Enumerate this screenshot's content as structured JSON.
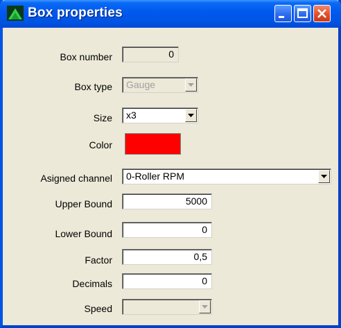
{
  "window": {
    "title": "Box properties"
  },
  "fields": {
    "box_number": {
      "label": "Box number",
      "value": "0"
    },
    "box_type": {
      "label": "Box type",
      "value": "Gauge"
    },
    "size": {
      "label": "Size",
      "value": "x3"
    },
    "color": {
      "label": "Color",
      "value": "#ff0000"
    },
    "assigned_channel": {
      "label": "Asigned channel",
      "value": "0-Roller RPM"
    },
    "upper_bound": {
      "label": "Upper Bound",
      "value": "5000"
    },
    "lower_bound": {
      "label": "Lower Bound",
      "value": "0"
    },
    "factor": {
      "label": "Factor",
      "value": "0,5"
    },
    "decimals": {
      "label": "Decimals",
      "value": "0"
    },
    "speed": {
      "label": "Speed",
      "value": ""
    }
  },
  "icons": {
    "app": "green-gauge-icon",
    "minimize": "minimize-icon",
    "maximize": "maximize-icon",
    "close": "close-icon",
    "dropdown": "chevron-down-icon"
  }
}
